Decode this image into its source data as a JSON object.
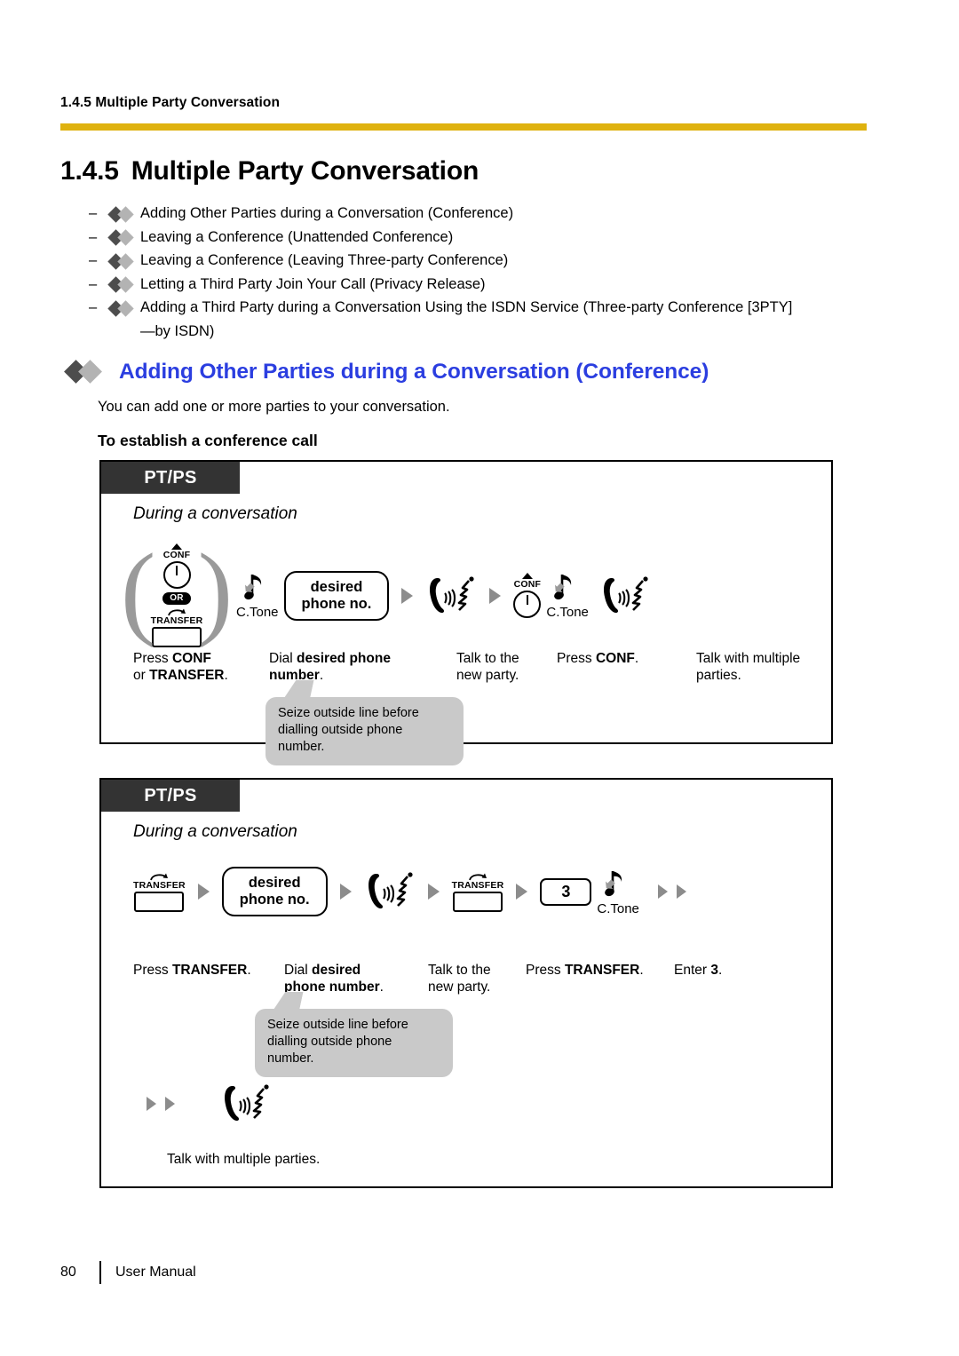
{
  "header": {
    "running_header": "1.4.5 Multiple Party Conversation",
    "rule_color": "#dfb20f"
  },
  "section": {
    "number": "1.4.5",
    "title": "Multiple Party Conversation"
  },
  "toc": {
    "dash": "–",
    "items": [
      "Adding Other Parties during a Conversation (Conference)",
      "Leaving a Conference (Unattended Conference)",
      "Leaving a Conference (Leaving Three-party Conference)",
      "Letting a Third Party Join Your Call (Privacy Release)",
      "Adding a Third Party during a Conversation Using the ISDN Service (Three-party Conference [3PTY]"
    ],
    "last_item_continuation": "—by ISDN)"
  },
  "subsection": {
    "heading": "Adding Other Parties during a Conversation (Conference)",
    "heading_color": "#2b3ee0",
    "lead": "You can add one or more parties to your conversation.",
    "procedure_title": "To establish a conference call"
  },
  "box1": {
    "badge": "PT/PS",
    "during": "During a conversation",
    "keys": {
      "conf_label": "CONF",
      "or_label": "OR",
      "transfer_label": "TRANSFER"
    },
    "ctone_label": "C.Tone",
    "pill_line1": "desired",
    "pill_line2": "phone no.",
    "captions": [
      {
        "line1_plain": "Press ",
        "line1_bold": "CONF",
        "line2_plain": "or ",
        "line2_bold": "TRANSFER",
        "line2_tail": "."
      },
      {
        "line1_plain": "Dial ",
        "line1_bold": "desired phone",
        "line2_bold": "number",
        "line2_tail": "."
      },
      {
        "line1_plain": "Talk to the",
        "line2_plain": "new party."
      },
      {
        "line1_plain": "Press ",
        "line1_bold": "CONF",
        "line1_tail": "."
      },
      {
        "line1_plain": "Talk with multiple",
        "line2_plain": "parties."
      }
    ],
    "callout_line1": "Seize outside line before",
    "callout_line2": "dialling outside phone number."
  },
  "box2": {
    "badge": "PT/PS",
    "during": "During a conversation",
    "keys": {
      "transfer_label": "TRANSFER"
    },
    "ctone_label": "C.Tone",
    "pill_line1": "desired",
    "pill_line2": "phone no.",
    "keycap_3": "3",
    "captions": [
      {
        "line1_plain": "Press ",
        "line1_bold": "TRANSFER",
        "line1_tail": "."
      },
      {
        "line1_plain": "Dial ",
        "line1_bold": "desired",
        "line2_bold": "phone number",
        "line2_tail": "."
      },
      {
        "line1_plain": "Talk to the",
        "line2_plain": "new party."
      },
      {
        "line1_plain": "Press ",
        "line1_bold": "TRANSFER",
        "line1_tail": "."
      },
      {
        "line1_plain": "Enter ",
        "line1_bold": "3",
        "line1_tail": "."
      }
    ],
    "callout_line1": "Seize outside line before",
    "callout_line2": "dialling outside phone number.",
    "final_caption": "Talk with multiple parties."
  },
  "footer": {
    "page_number": "80",
    "doc_name": "User Manual"
  }
}
